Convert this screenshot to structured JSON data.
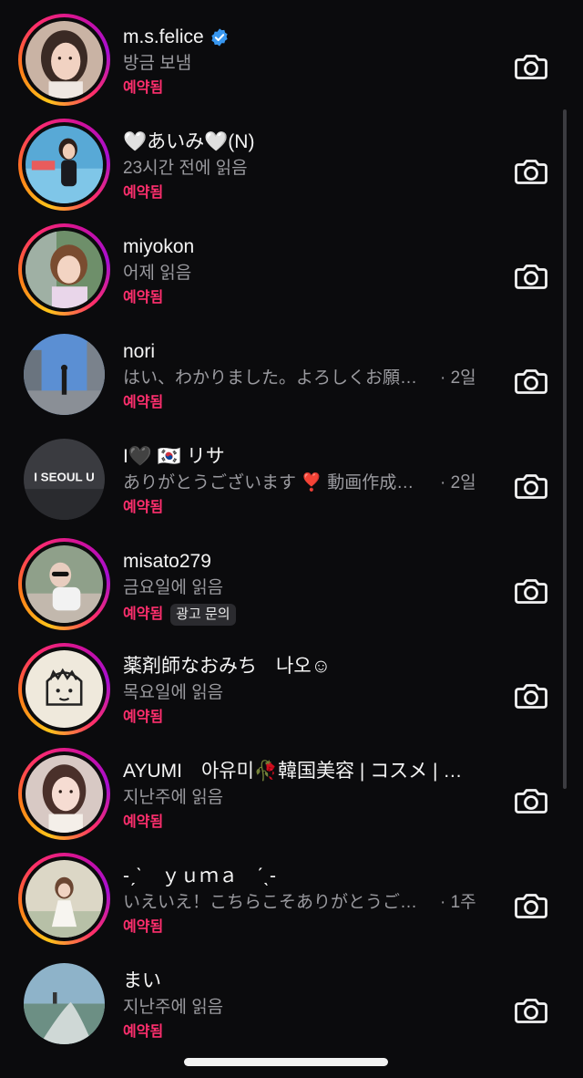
{
  "accent_colors": {
    "scheduled": "#ff2f6e",
    "verified": "#3897f0",
    "story_ring": [
      "#ffc41a",
      "#ff2e6a",
      "#a60fd1"
    ]
  },
  "threads": [
    {
      "name": "m.s.felice",
      "verified": true,
      "status": "방금 보냄",
      "time": "",
      "tag": "예약됨",
      "badge": "",
      "ring": true,
      "avatar": "portrait-woman-dark-hair"
    },
    {
      "name": "🤍あいみ🤍(N)",
      "verified": false,
      "status": "23시간 전에 읽음",
      "time": "",
      "tag": "예약됨",
      "badge": "",
      "ring": true,
      "avatar": "portrait-poolside"
    },
    {
      "name": "miyokon",
      "verified": false,
      "status": "어제 읽음",
      "time": "",
      "tag": "예약됨",
      "badge": "",
      "ring": true,
      "avatar": "portrait-outdoor"
    },
    {
      "name": "nori",
      "verified": false,
      "status": "はい、わかりました。よろしくお願いします",
      "time": "· 2일",
      "tag": "예약됨",
      "badge": "",
      "ring": false,
      "avatar": "city-street"
    },
    {
      "name": "I🖤 🇰🇷 リサ",
      "verified": false,
      "status": "ありがとうございます ❣️ 動画作成の件",
      "time": "· 2일",
      "tag": "예약됨",
      "badge": "",
      "ring": false,
      "avatar": "seoul-sign"
    },
    {
      "name": "misato279",
      "verified": false,
      "status": "금요일에 읽음",
      "time": "",
      "tag": "예약됨",
      "badge": "광고 문의",
      "ring": true,
      "avatar": "portrait-sunglasses"
    },
    {
      "name": "薬剤師なおみち　나오☺",
      "verified": false,
      "status": "목요일에 읽음",
      "time": "",
      "tag": "예약됨",
      "badge": "",
      "ring": true,
      "avatar": "cartoon-face"
    },
    {
      "name": "AYUMI　아유미🥀韓国美容 | コスメ | 美容皮膚科",
      "verified": false,
      "status": "지난주에 읽음",
      "time": "",
      "tag": "예약됨",
      "badge": "",
      "ring": true,
      "avatar": "portrait-glam"
    },
    {
      "name": "-ˏˋ　ｙｕｍａ　ˊˎ-",
      "verified": false,
      "status": "いえいえ！こちらこそありがとうございます",
      "time": "· 1주",
      "tag": "예약됨",
      "badge": "",
      "ring": true,
      "avatar": "portrait-white-dress"
    },
    {
      "name": "まい",
      "verified": false,
      "status": "지난주에 읽음",
      "time": "",
      "tag": "예약됨",
      "badge": "",
      "ring": false,
      "avatar": "landscape-path"
    }
  ],
  "icons": {
    "camera": "camera-icon",
    "verified": "verified-badge-icon"
  }
}
